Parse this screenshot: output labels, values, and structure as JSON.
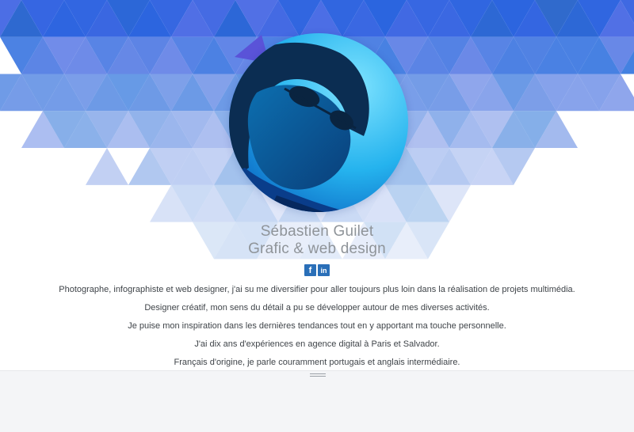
{
  "profile": {
    "name": "Sébastien Guilet",
    "role": "Grafic & web design"
  },
  "social": [
    {
      "icon": "facebook-icon",
      "glyph": "f"
    },
    {
      "icon": "linkedin-icon",
      "glyph": "in"
    }
  ],
  "bio": [
    "Photographe, infographiste et web designer, j'ai su me diversifier pour aller toujours plus loin dans la réalisation de projets multimédia.",
    "Designer créatif, mon sens du détail a pu se développer autour de mes diverses activités.",
    "Je puise mon inspiration dans les dernières tendances tout en y apportant ma touche personnelle.",
    "J'ai dix ans d'expériences en agence digital à Paris et Salvador.",
    "Français d'origine, je parle couramment portugais et anglais intermédiaire."
  ],
  "colors": {
    "accent": "#2a6fb8",
    "name_text": "#8f9499",
    "bio_text": "#3f4449",
    "footer": "#f4f5f7"
  }
}
